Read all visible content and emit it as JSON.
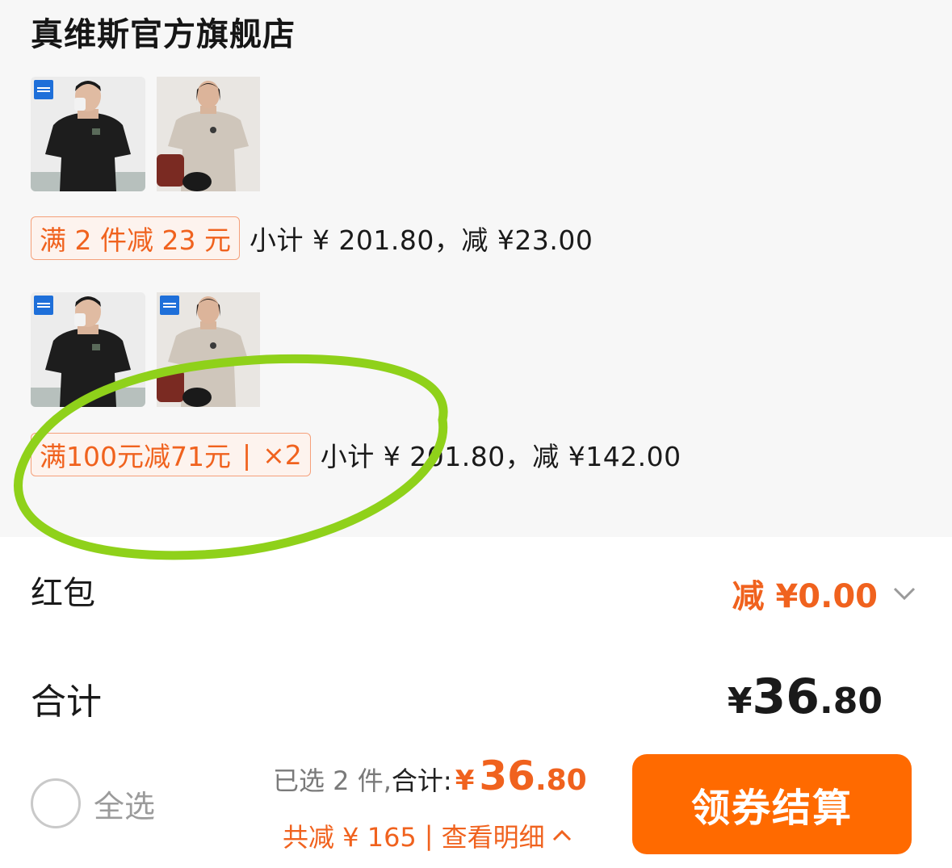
{
  "store": {
    "name": "真维斯官方旗舰店"
  },
  "groups": [
    {
      "items": [
        {
          "alt": "black-tshirt-product",
          "shirt_color": "#1d1d1d"
        },
        {
          "alt": "beige-tshirt-product",
          "shirt_color": "#cfc6bb"
        }
      ],
      "promo": {
        "text": "满 2 件减 23 元"
      },
      "subtotal": "小计 ¥ 201.80，减 ¥23.00"
    },
    {
      "items": [
        {
          "alt": "black-tshirt-product",
          "shirt_color": "#1d1d1d"
        },
        {
          "alt": "beige-tshirt-product",
          "shirt_color": "#cfc6bb"
        }
      ],
      "promo": {
        "text": "满100元减71元",
        "sep": "|",
        "multiplier": "×2"
      },
      "subtotal": "小计 ¥ 201.80，减 ¥142.00"
    }
  ],
  "red_packet": {
    "label": "红包",
    "value": "减 ¥0.00"
  },
  "total": {
    "label": "合计",
    "currency": "¥",
    "integer": "36",
    "decimal": ".80"
  },
  "bottom_bar": {
    "select_all": "全选",
    "selected": "已选 2 件,",
    "total_label": "合计:",
    "currency": "¥",
    "integer": "36",
    "decimal": ".80",
    "saved": "共减 ¥ 165",
    "sep": "|",
    "detail": "查看明细",
    "checkout": "领券结算"
  },
  "colors": {
    "accent": "#ff6a00",
    "promo": "#f0621e",
    "annotation": "#8fd11a"
  }
}
